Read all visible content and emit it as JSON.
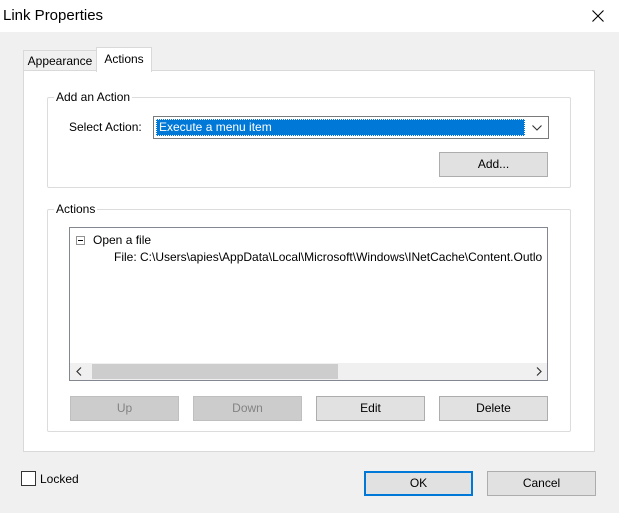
{
  "window": {
    "title": "Link Properties"
  },
  "tabs": [
    {
      "label": "Appearance"
    },
    {
      "label": "Actions"
    }
  ],
  "add_action": {
    "group_label": "Add an Action",
    "select_label": "Select Action:",
    "selected_value": "Execute a menu item",
    "add_button": "Add..."
  },
  "actions": {
    "group_label": "Actions",
    "tree": {
      "root": "Open a file",
      "child": "File: C:\\Users\\apies\\AppData\\Local\\Microsoft\\Windows\\INetCache\\Content.Outlo"
    },
    "buttons": {
      "up": "Up",
      "down": "Down",
      "edit": "Edit",
      "delete": "Delete"
    }
  },
  "footer": {
    "locked_label": "Locked",
    "locked_checked": false,
    "ok": "OK",
    "cancel": "Cancel"
  },
  "icons": [
    "close-icon",
    "chevron-down-icon",
    "collapse-icon",
    "scroll-left-icon",
    "scroll-right-icon"
  ]
}
